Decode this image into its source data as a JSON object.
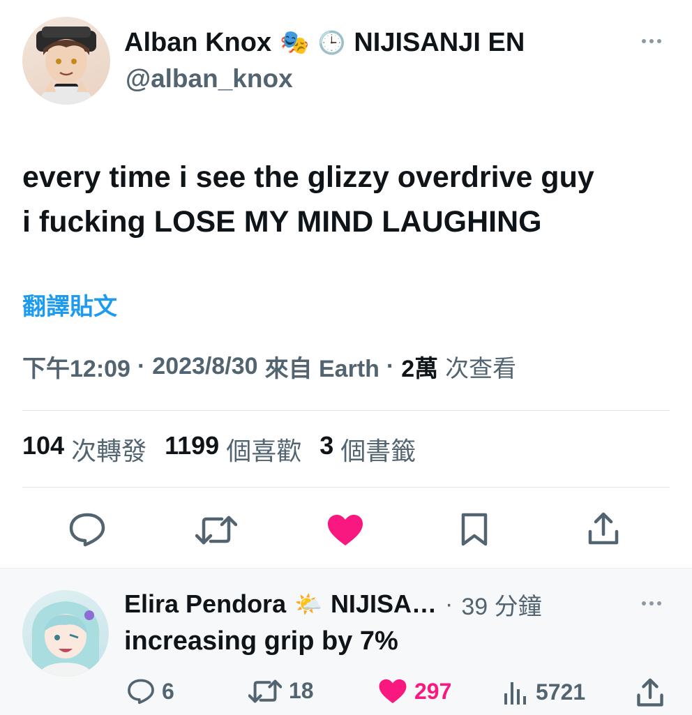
{
  "tweet": {
    "author_name": "Alban Knox",
    "author_emoji": "🎭",
    "clock_emoji": "🕒",
    "affiliation": "NIJISANJI EN",
    "handle": "@alban_knox",
    "text_line1": "every time i see the glizzy overdrive guy",
    "text_line2": "i fucking LOSE MY MIND LAUGHING",
    "translate_label": "翻譯貼文",
    "time": "下午12:09",
    "date": "2023/8/30",
    "source": "來自 Earth",
    "separator": "·",
    "views_count": "2萬",
    "views_label": "次查看"
  },
  "stats": {
    "retweets_count": "104",
    "retweets_label": "次轉發",
    "likes_count": "1199",
    "likes_label": "個喜歡",
    "bookmarks_count": "3",
    "bookmarks_label": "個書籤"
  },
  "actions": [
    "reply",
    "retweet",
    "like",
    "bookmark",
    "share"
  ],
  "reply": {
    "author_name": "Elira Pendora",
    "author_emoji": "🌤️",
    "affiliation": "NIJISA…",
    "separator": "·",
    "time": "39 分鐘",
    "text": "increasing grip by 7%",
    "replies": "6",
    "retweets": "18",
    "likes": "297",
    "views": "5721"
  },
  "colors": {
    "like_pink": "#f91880",
    "link_blue": "#1d9bf0",
    "grey": "#536471"
  }
}
